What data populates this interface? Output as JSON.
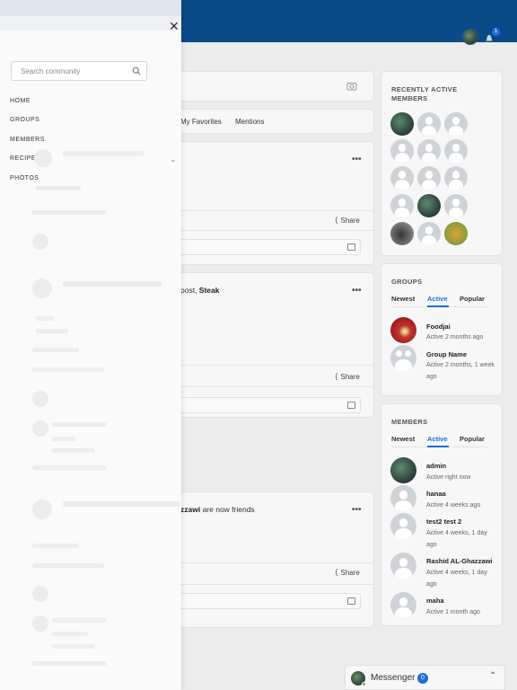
{
  "header": {
    "notification_count": "1"
  },
  "feed": {
    "post_placeholder_icon": "camera-icon",
    "tabs": [
      "My Favorites",
      "Mentions"
    ],
    "share_label": "Share",
    "posts": [
      {
        "text_user": "",
        "text_action": "",
        "text_object": ""
      },
      {
        "text_action": "post, ",
        "text_object": "Steak"
      },
      {
        "text_user": "zzawi",
        "text_action": " are now friends"
      }
    ]
  },
  "sidebar_right": {
    "recently_active": {
      "title": "RECENTLY ACTIVE MEMBERS"
    },
    "groups": {
      "title": "GROUPS",
      "tabs": [
        "Newest",
        "Active",
        "Popular"
      ],
      "active_tab": "Active",
      "items": [
        {
          "name": "Foodjai",
          "meta": "Active 2 months ago"
        },
        {
          "name": "Group Name",
          "meta": "Active 2 months, 1 week ago"
        }
      ]
    },
    "members": {
      "title": "MEMBERS",
      "tabs": [
        "Newest",
        "Active",
        "Popular"
      ],
      "active_tab": "Active",
      "items": [
        {
          "name": "admin",
          "meta": "Active right now"
        },
        {
          "name": "hanaa",
          "meta": "Active 4 weeks ago"
        },
        {
          "name": "test2 test 2",
          "meta": "Active 4 weeks, 1 day ago"
        },
        {
          "name": "Rashid AL-Ghazzawi",
          "meta": "Active 4 weeks, 1 day ago"
        },
        {
          "name": "maha",
          "meta": "Active 1 month ago"
        }
      ]
    }
  },
  "messenger": {
    "label": "Messenger",
    "count": "0"
  },
  "drawer": {
    "search_placeholder": "Search community",
    "nav": [
      "HOME",
      "GROUPS",
      "MEMBERS",
      "RECIPES",
      "PHOTOS"
    ]
  },
  "colors": {
    "header_blue": "#0a4a86",
    "accent": "#1e6fd9"
  }
}
